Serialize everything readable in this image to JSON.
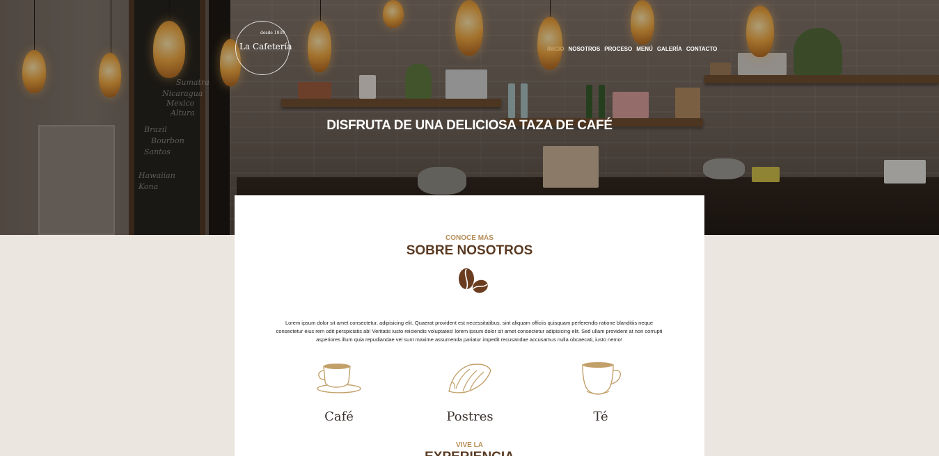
{
  "brand": {
    "since": "desde 1939",
    "name": "La Cafetería"
  },
  "nav": {
    "items": [
      "INICIO",
      "NOSOTROS",
      "PROCESO",
      "MENÚ",
      "GALERÍA",
      "CONTACTO"
    ],
    "active": "INICIO"
  },
  "hero": {
    "title": "DISFRUTA DE UNA DELICIOSA TAZA DE CAFÉ",
    "chalkboard": [
      "Brazil",
      "Bourbon",
      "Santos",
      "Hawaiian",
      "Kona",
      "Nicaragua",
      "Mexico",
      "Altura",
      "Sumatra"
    ]
  },
  "about": {
    "eyebrow": "CONOCE MÁS",
    "title": "SOBRE NOSOTROS",
    "body": "Lorem ipsum dolor sit amet consectetur, adipisicing elit. Quaerat provident est necessitatibus, sint aliquam officiis quisquam perferendis ratione blanditiis neque consectetur eius rem odit perspiciatis ab! Veritatis iusto reiciendis voluptates! lorem ipsum dolor sit amet consectetur adipisicing elit. Sed ullam provident at non corrupti asperiores illum quia repudiandae vel sunt maxime assumenda pariatur impedit recusandae accusamus nulla obcaecati, iusto nemo!",
    "features": [
      {
        "label": "Café",
        "icon": "coffee-cup-icon"
      },
      {
        "label": "Postres",
        "icon": "croissant-icon"
      },
      {
        "label": "Té",
        "icon": "tea-cup-icon"
      }
    ]
  },
  "experience": {
    "eyebrow": "VIVE LA",
    "title": "EXPERIENCIA"
  },
  "colors": {
    "accent": "#b58d57",
    "heading": "#5a3a22",
    "background": "#ebe6df"
  }
}
